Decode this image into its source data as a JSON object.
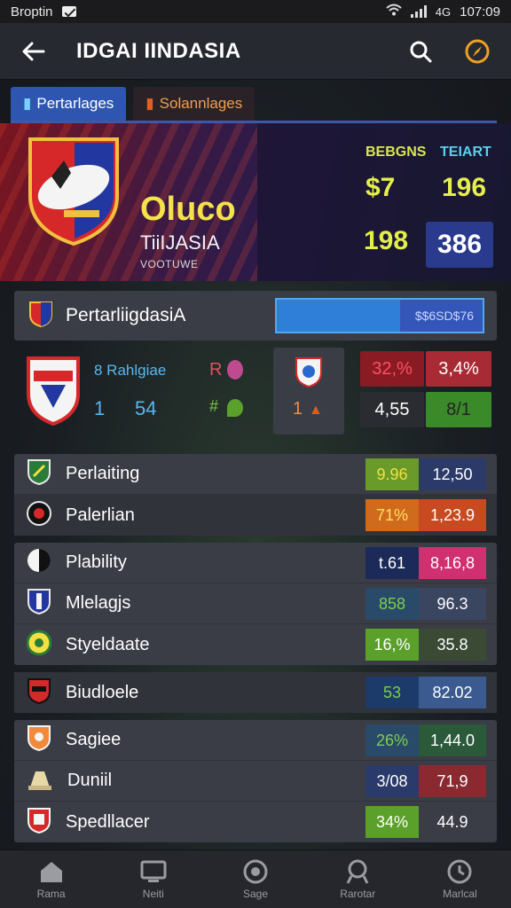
{
  "status": {
    "carrier": "Broptin",
    "time": "107:09",
    "network": "4G"
  },
  "appbar": {
    "title": "IDGAI IINDASIA"
  },
  "tabs": [
    {
      "label": "Pertarlages",
      "active": true
    },
    {
      "label": "Solannlages",
      "active": false
    }
  ],
  "hero": {
    "club_name": "Oluco",
    "club_sub": "TiiIJASIA",
    "club_small": "VOOTUWE",
    "col1_header": "BEBGNS",
    "col2_header": "TEIART",
    "v1": "$7",
    "v2": "196",
    "v3": "198",
    "v4": "386"
  },
  "section": {
    "label": "PertarliigdasiA",
    "progress_text": "$$6SD$76",
    "progress_fraction": 0.4
  },
  "match": {
    "name": "8 Rahlgiae",
    "n1": "1",
    "n2": "54",
    "m1": "R",
    "m2": "#",
    "center_num": "1",
    "cells": [
      "32,%",
      "3,4%",
      "4,55",
      "8/1"
    ]
  },
  "rows": [
    {
      "group": 1,
      "label": "Perlaiting",
      "v1": "9.96",
      "v2": "12,50",
      "c1": "#6a9a2a",
      "c2": "#2c3a6a",
      "t1": "#f2e040",
      "t2": "#ffffff"
    },
    {
      "group": 1,
      "label": "Palerlian",
      "v1": "71%",
      "v2": "1,23.9",
      "c1": "#d06a1c",
      "c2": "#c84a20",
      "t1": "#ffe060",
      "t2": "#ffffff"
    },
    {
      "group": 2,
      "label": "Plability",
      "v1": "t.61",
      "v2": "8,16,8",
      "c1": "#1c2a5a",
      "c2": "#d03070",
      "t1": "#ffffff",
      "t2": "#ffffff"
    },
    {
      "group": 2,
      "label": "Mlelagjs",
      "v1": "858",
      "v2": "96.3",
      "c1": "#2a4a6a",
      "c2": "#3a4560",
      "t1": "#7ad04a",
      "t2": "#ffffff"
    },
    {
      "group": 2,
      "label": "Styeldaate",
      "v1": "16,%",
      "v2": "35.8",
      "c1": "#5aa02a",
      "c2": "#3a4a34",
      "t1": "#ffffff",
      "t2": "#ffffff"
    },
    {
      "group": 3,
      "label": "Biudloele",
      "v1": "53",
      "v2": "82.02",
      "c1": "#1c3a6a",
      "c2": "#3a5a90",
      "t1": "#7ad04a",
      "t2": "#ffffff"
    },
    {
      "group": 4,
      "label": "Sagiee",
      "v1": "26%",
      "v2": "1,44.0",
      "c1": "#2a4a6a",
      "c2": "#2a5a3a",
      "t1": "#7ad04a",
      "t2": "#ffffff"
    },
    {
      "group": 4,
      "label": "Duniil",
      "v1": "3/08",
      "v2": "71,9",
      "c1": "#2a3a6a",
      "c2": "#8a2a30",
      "t1": "#ffffff",
      "t2": "#ffffff"
    },
    {
      "group": 4,
      "label": "Spedllacer",
      "v1": "34%",
      "v2": "44.9",
      "c1": "#5aa02a",
      "c2": "#3a3d45",
      "t1": "#ffffff",
      "t2": "#ffffff"
    }
  ],
  "nav": [
    {
      "label": "Rama",
      "icon": "home-icon"
    },
    {
      "label": "Neiti",
      "icon": "tv-icon"
    },
    {
      "label": "Sage",
      "icon": "ball-icon"
    },
    {
      "label": "Rarotar",
      "icon": "trophy-icon"
    },
    {
      "label": "Marlcal",
      "icon": "clock-icon"
    }
  ]
}
